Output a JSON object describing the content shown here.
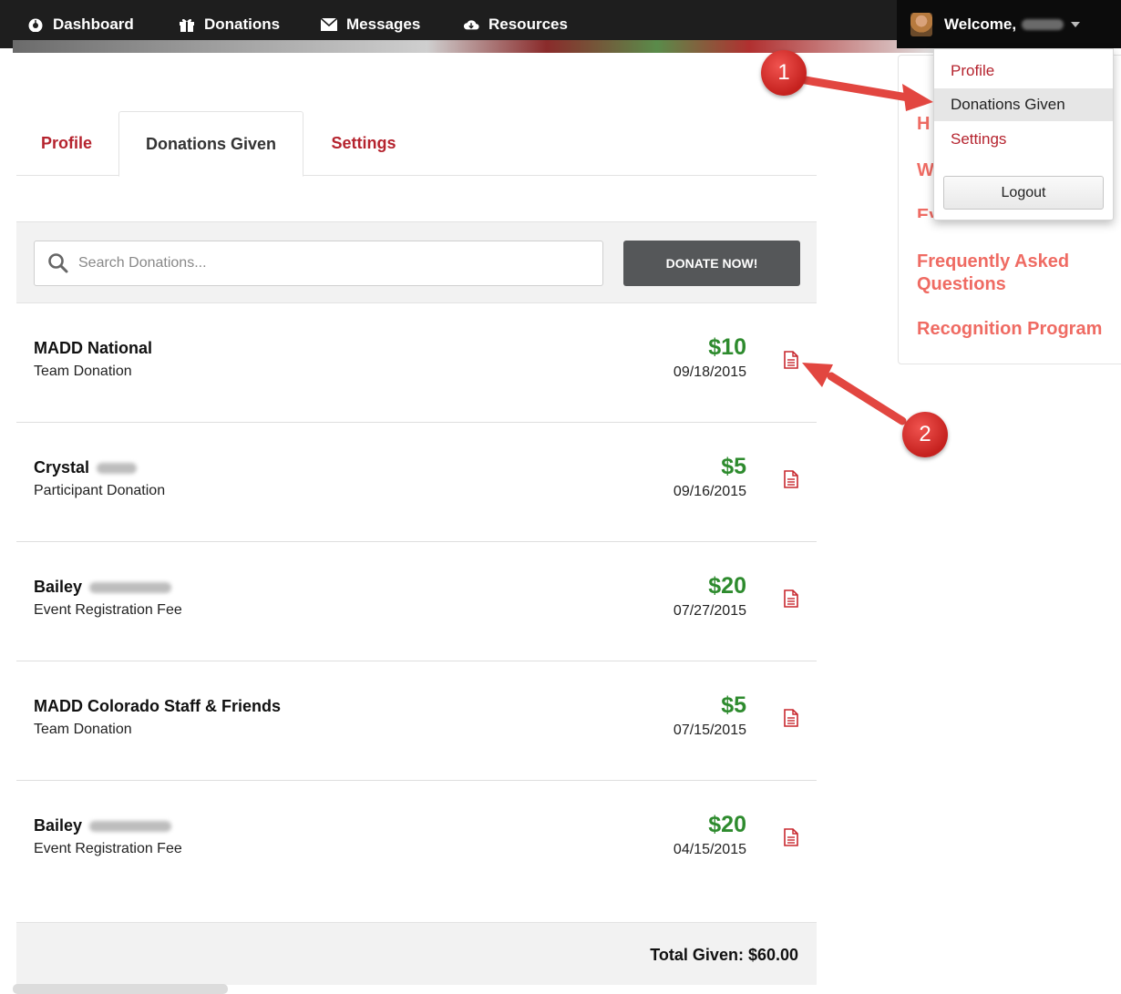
{
  "nav": {
    "items": [
      {
        "label": "Dashboard",
        "icon": "dashboard-icon"
      },
      {
        "label": "Donations",
        "icon": "gift-icon"
      },
      {
        "label": "Messages",
        "icon": "envelope-icon"
      },
      {
        "label": "Resources",
        "icon": "cloud-download-icon"
      }
    ],
    "welcome_label": "Welcome,"
  },
  "dropdown": {
    "items": [
      "Profile",
      "Donations Given",
      "Settings"
    ],
    "active": "Donations Given",
    "logout_label": "Logout"
  },
  "tabs": [
    {
      "label": "Profile",
      "active": false
    },
    {
      "label": "Donations Given",
      "active": true
    },
    {
      "label": "Settings",
      "active": false
    }
  ],
  "search": {
    "placeholder": "Search Donations...",
    "value": "",
    "donate_label": "DONATE NOW!"
  },
  "donations": [
    {
      "name": "MADD National",
      "type": "Team Donation",
      "amount": "$10",
      "date": "09/18/2015"
    },
    {
      "name": "Crystal",
      "type": "Participant Donation",
      "amount": "$5",
      "date": "09/16/2015"
    },
    {
      "name": "Bailey",
      "type": "Event Registration Fee",
      "amount": "$20",
      "date": "07/27/2015"
    },
    {
      "name": "MADD Colorado Staff & Friends",
      "type": "Team Donation",
      "amount": "$5",
      "date": "07/15/2015"
    },
    {
      "name": "Bailey",
      "type": "Event Registration Fee",
      "amount": "$20",
      "date": "04/15/2015"
    }
  ],
  "total_label": "Total Given: $60.00",
  "sidebar": {
    "links": [
      "Frequently Asked Questions",
      "Recognition Program"
    ]
  },
  "annotations": [
    "1",
    "2"
  ],
  "colors": {
    "brand_red": "#b5232e",
    "amount_green": "#2e8b2e",
    "sidebar_link": "#ef6b63",
    "nav_bg": "#1e1e1e"
  }
}
